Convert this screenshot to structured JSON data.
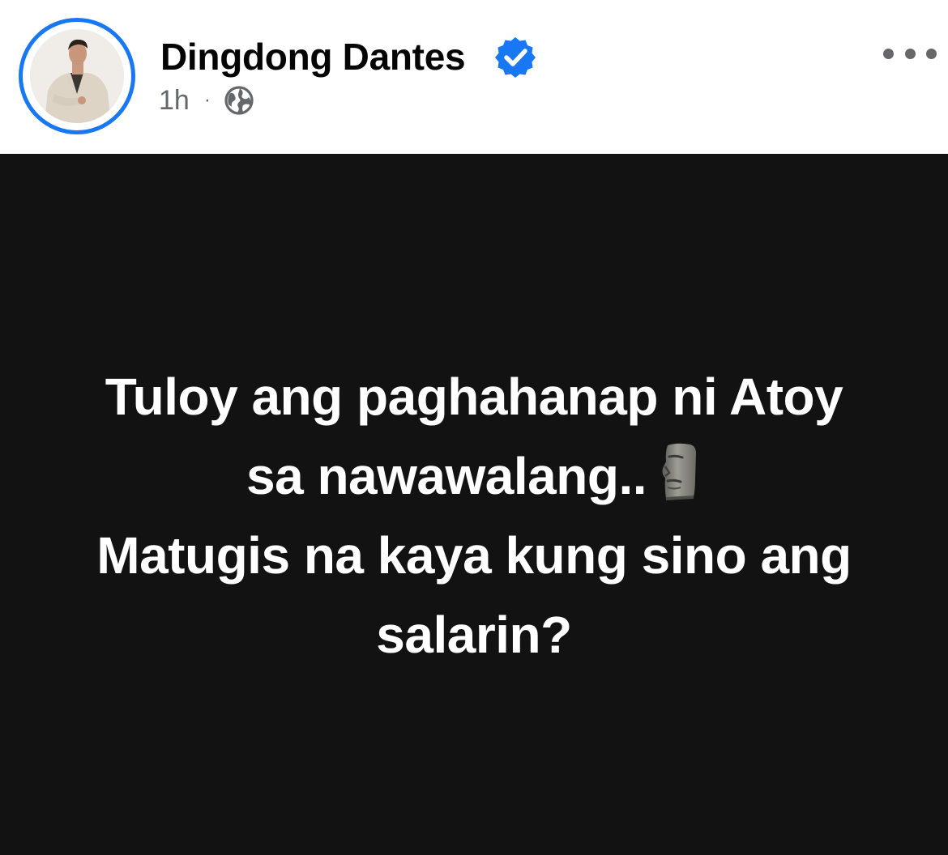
{
  "post": {
    "author": {
      "name": "Dingdong Dantes",
      "verified": true,
      "avatar": "profile-photo"
    },
    "timestamp": "1h",
    "separator": "·",
    "privacy_icon": "globe-icon",
    "more_icon": "more-horizontal-icon",
    "text_lines": [
      "Tuloy ang paghahanap ni Atoy",
      "sa nawawalang..",
      "Matugis na kaya kung sino ang",
      "salarin?"
    ],
    "emoji": "moai-icon",
    "background_color": "#121212",
    "accent_color": "#1877f2"
  }
}
